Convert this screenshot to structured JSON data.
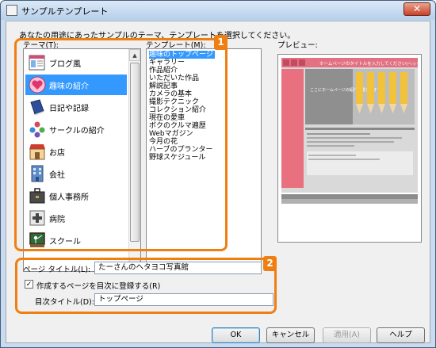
{
  "window": {
    "title": "サンプルテンプレート",
    "close_glyph": "✕"
  },
  "instruction": "あなたの用途にあったサンプルのテーマ、テンプレートを選択してください。",
  "theme_label": "テーマ(T):",
  "template_label": "テンプレート(M):",
  "preview_label": "プレビュー:",
  "themes": [
    {
      "label": "ブログ風",
      "icon": "blog-icon"
    },
    {
      "label": "趣味の紹介",
      "icon": "heart-icon",
      "selected": true
    },
    {
      "label": "日記や記録",
      "icon": "diary-book-icon"
    },
    {
      "label": "サークルの紹介",
      "icon": "people-icon"
    },
    {
      "label": "お店",
      "icon": "shop-icon"
    },
    {
      "label": "会社",
      "icon": "building-icon"
    },
    {
      "label": "個人事務所",
      "icon": "briefcase-icon"
    },
    {
      "label": "病院",
      "icon": "hospital-icon"
    },
    {
      "label": "スクール",
      "icon": "school-icon"
    }
  ],
  "templates": [
    "趣味のトップページ",
    "ギャラリー",
    "作品紹介",
    "いただいた作品",
    "解説記事",
    "カメラの基本",
    "撮影テクニック",
    "コレクション紹介",
    "現在の愛車",
    "ボクのクルマ遍歴",
    "Webマガジン",
    "今月の花",
    "ハーブのプランター",
    "野球スケジュール"
  ],
  "selected_template": "趣味のトップページ",
  "preview": {
    "header_text": "ホームページのタイトルを入力してください(ヘッダー)",
    "intro_text": "ここにホームページの紹介を書きます"
  },
  "callouts": {
    "one": "1",
    "two": "2"
  },
  "page_title_label": "ページ タイトル(L):",
  "page_title_value": "たーさんのヘタヨコ写真館",
  "register_checkbox_label": "作成するページを目次に登録する(R)",
  "register_checked": true,
  "toc_title_label": "目次タイトル(D):",
  "toc_title_value": "トップページ",
  "buttons": {
    "ok": "OK",
    "cancel": "キャンセル",
    "apply": "適用(A)",
    "help": "ヘルプ"
  },
  "colors": {
    "accent": "#f07f12",
    "selection": "#3399ff",
    "preview_pink": "#e9707f"
  }
}
